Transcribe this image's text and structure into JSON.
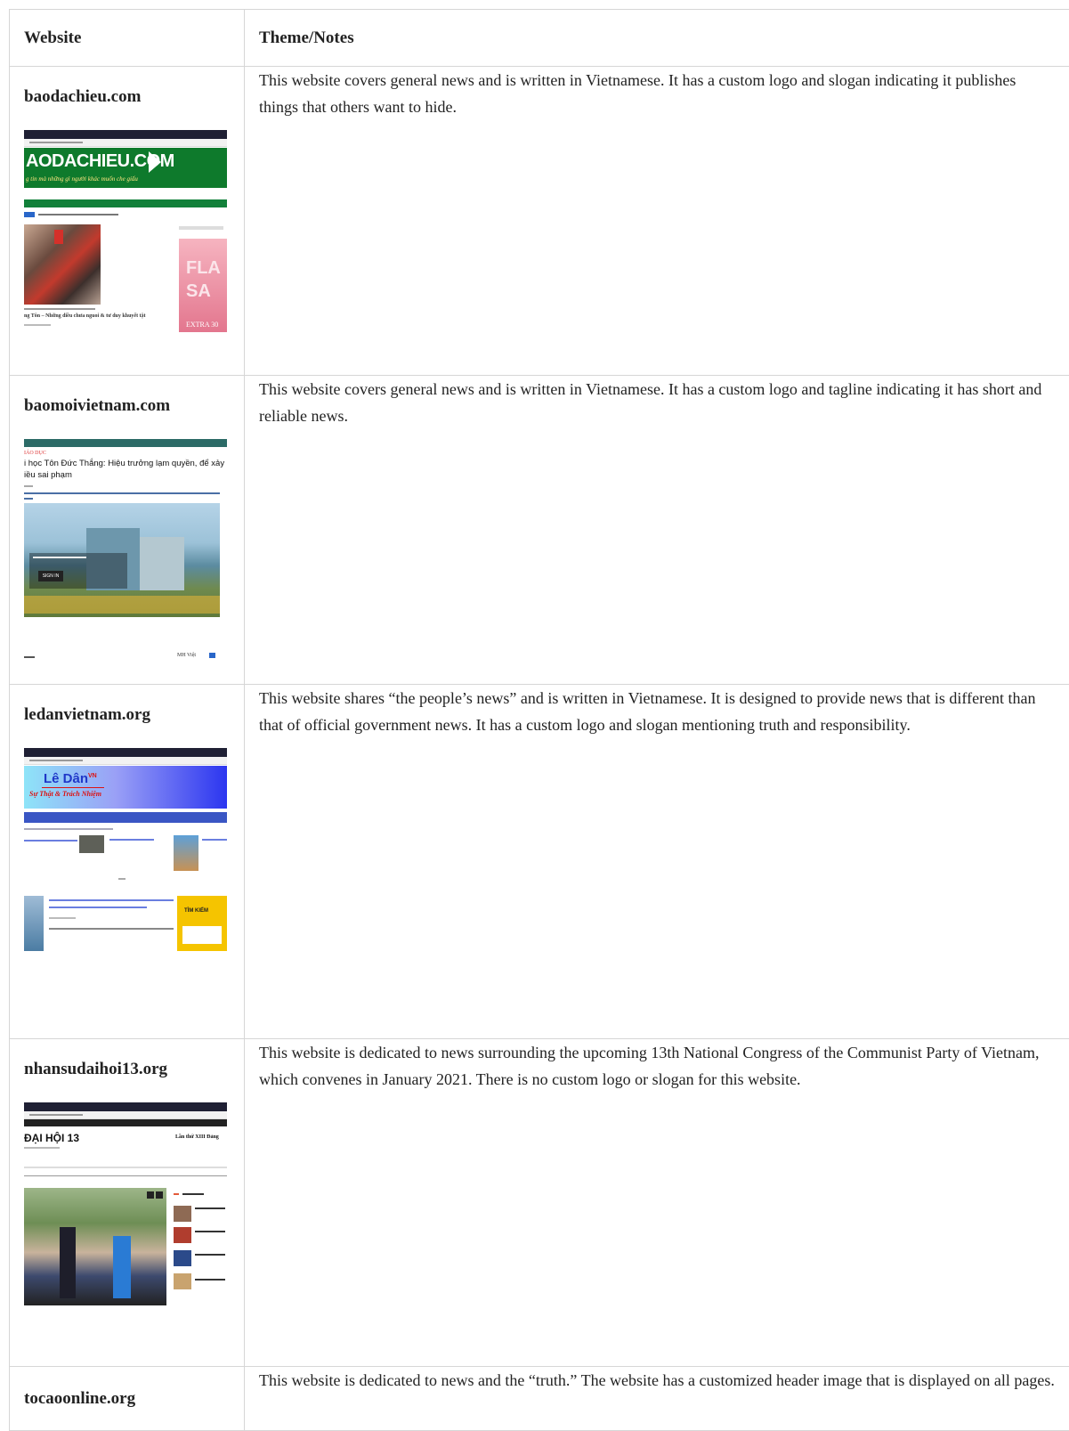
{
  "table": {
    "headers": {
      "website": "Website",
      "notes": "Theme/Notes"
    },
    "rows": [
      {
        "site": "baodachieu.com",
        "note": "This website covers general news and is written in Vietnamese. It has a custom logo and slogan indicating it publishes things that others want to hide.",
        "screenshot": {
          "logo": "AODACHIEU.COM",
          "slogan": "g tin mà những gì người khác muốn che giấu",
          "headline": "ng Tôn – Những điều chưa nguoi & tư duy khuyết tật",
          "ad_top": "FLA",
          "ad_bottom": "SA",
          "ad_footer": "EXTRA 30",
          "brand_color": "#0e7a2c"
        }
      },
      {
        "site": "baomoivietnam.com",
        "note": "This website covers general news and is written in Vietnamese. It has a custom logo and tagline indicating it has short and reliable news.",
        "screenshot": {
          "section": "IÁO DỤC",
          "headline_1": "i học Tôn Đức Thắng: Hiệu trưởng lạm quyền, để xảy ra",
          "headline_2": "iều sai phạm",
          "signin": "SIGN IN",
          "footer_right": "MH Việt",
          "brand_color": "#2c6b67"
        }
      },
      {
        "site": "ledanvietnam.org",
        "note": "This website shares “the people’s news” and is written in Vietnamese. It is designed to provide news that is different than that of official government news. It has a custom logo and slogan mentioning truth and responsibility.",
        "screenshot": {
          "logo": "Lê Dân",
          "logo_sup": "VN",
          "slogan": "Sự Thật & Trách Nhiệm",
          "sidebar": "TÌM KIẾM",
          "brand_color": "#2a36f0"
        }
      },
      {
        "site": "nhansudaihoi13.org",
        "note": "This website is dedicated to news surrounding the upcoming 13th National Congress of the Communist Party of Vietnam, which convenes in January 2021. There is no custom logo or slogan for this website.",
        "screenshot": {
          "title": "ĐẠI HỘI 13",
          "header_right": "Lần thứ XIII Đảng"
        }
      },
      {
        "site": "tocaoonline.org",
        "note": "This website is dedicated to news and the “truth.” The website has a customized header image that is displayed on all pages."
      }
    ]
  }
}
